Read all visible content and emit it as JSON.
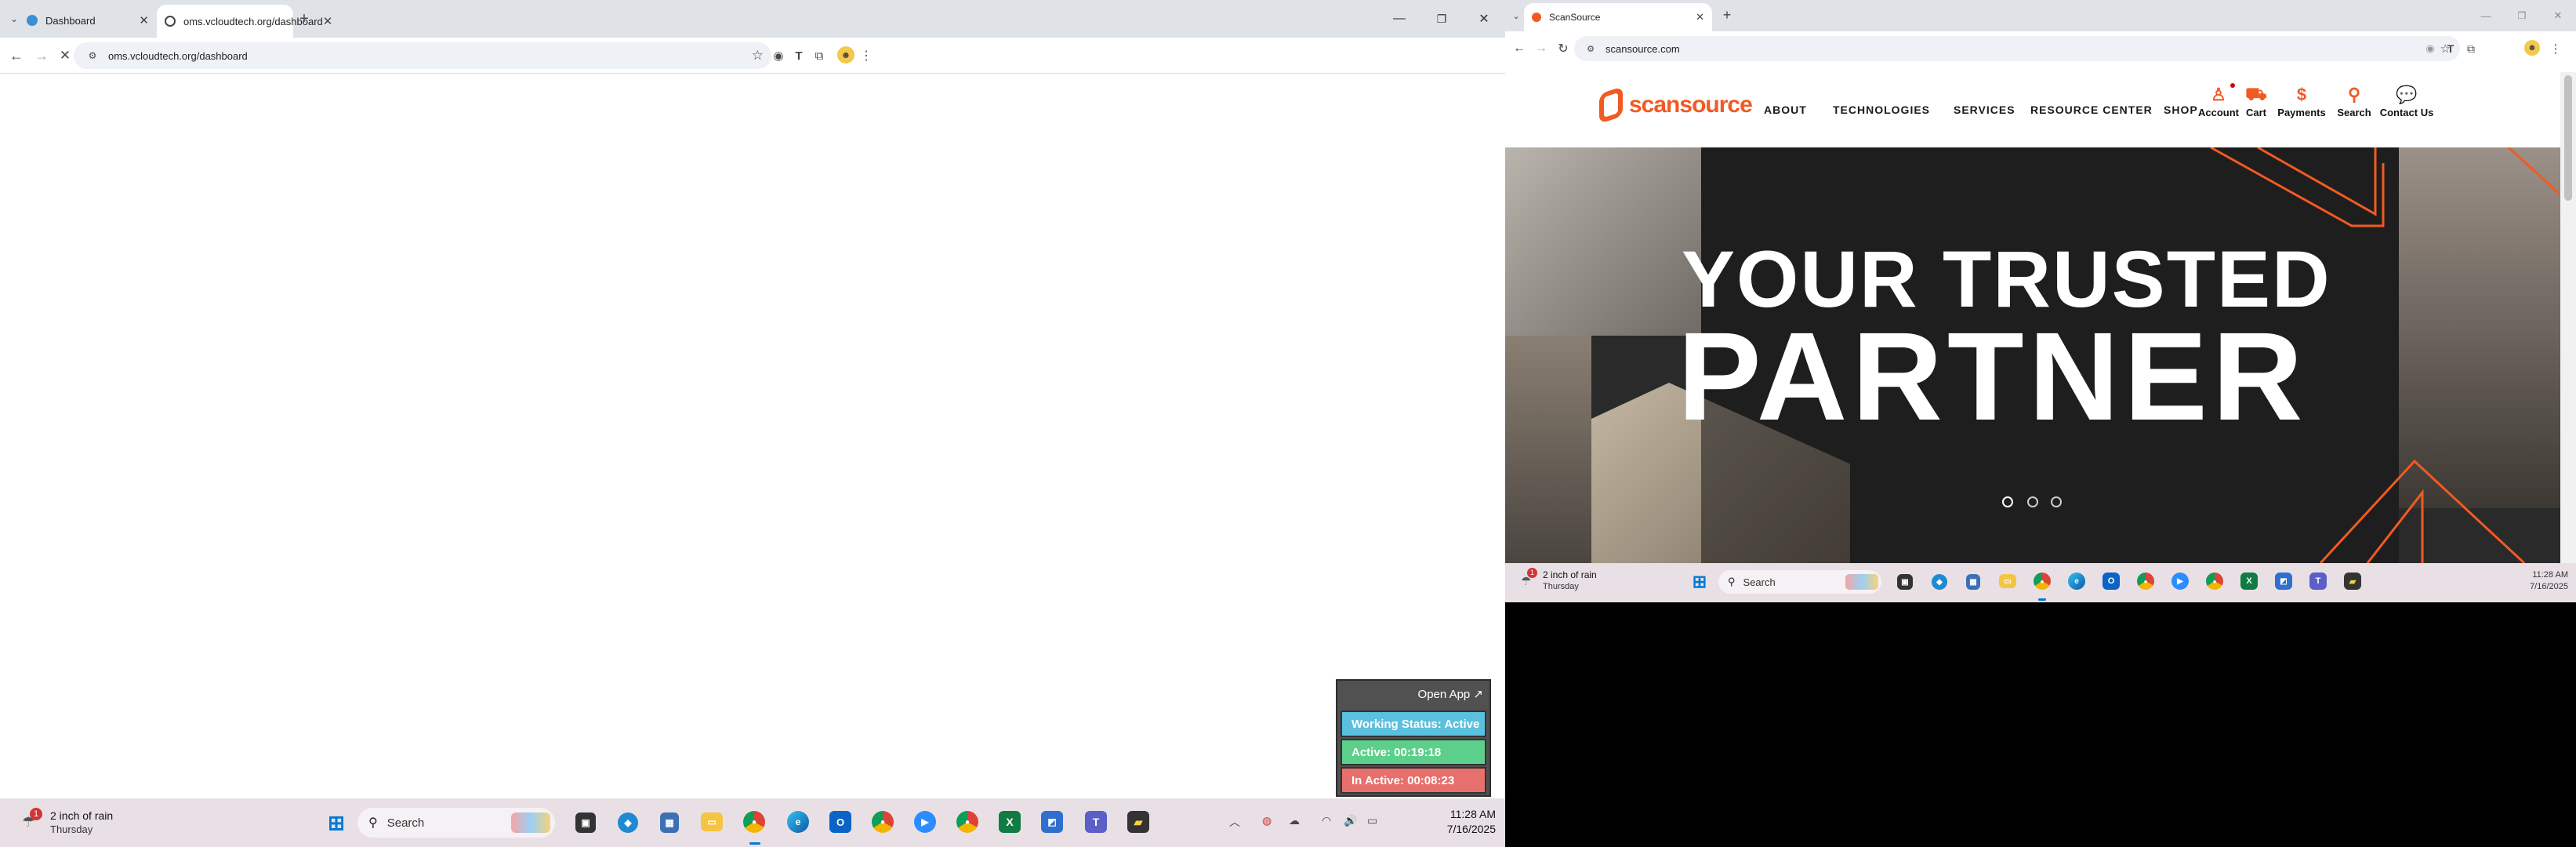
{
  "left": {
    "tabs": [
      {
        "title": "Dashboard",
        "active": false
      },
      {
        "title": "oms.vcloudtech.org/dashboard",
        "active": true
      }
    ],
    "url": "oms.vcloudtech.org/dashboard",
    "widget": {
      "open_app": "Open App ↗",
      "working_status": "Working Status: Active",
      "active": "Active: 00:19:18",
      "inactive": "In Active: 00:08:23",
      "colors": {
        "working": "#5bc0de",
        "active": "#5cd08a",
        "inactive": "#e8706c"
      }
    },
    "taskbar": {
      "weather_badge": "1",
      "weather_line1": "2 inch of rain",
      "weather_line2": "Thursday",
      "search_placeholder": "Search",
      "time": "11:28 AM",
      "date": "7/16/2025"
    }
  },
  "right": {
    "tab": {
      "title": "ScanSource"
    },
    "url": "scansource.com",
    "site": {
      "logo_text": "scansource",
      "nav": [
        "ABOUT",
        "TECHNOLOGIES",
        "SERVICES",
        "RESOURCE CENTER",
        "SHOP"
      ],
      "utility": [
        {
          "label": "Account",
          "icon": "person-icon"
        },
        {
          "label": "Cart",
          "icon": "cart-icon"
        },
        {
          "label": "Payments",
          "icon": "dollar-icon"
        },
        {
          "label": "Search",
          "icon": "search-icon"
        },
        {
          "label": "Contact Us",
          "icon": "chat-icon"
        }
      ],
      "hero_line1": "YOUR TRUSTED",
      "hero_line2": "PARTNER",
      "slide_count": 3,
      "active_slide": 1,
      "accent": "#f15a22"
    },
    "taskbar": {
      "weather_badge": "1",
      "weather_line1": "2 inch of rain",
      "weather_line2": "Thursday",
      "search_placeholder": "Search",
      "time": "11:28 AM",
      "date": "7/16/2025"
    }
  }
}
